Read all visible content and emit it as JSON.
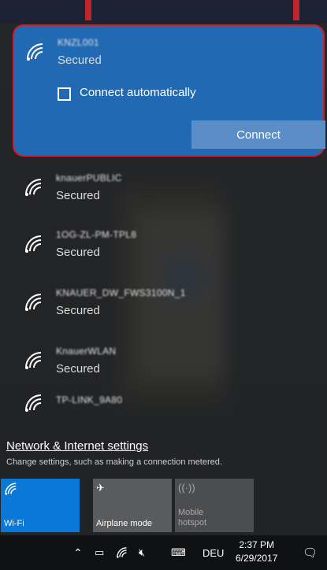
{
  "selected_network": {
    "name": "KNZL001",
    "status": "Secured",
    "connect_automatically_label": "Connect automatically",
    "connect_button": "Connect"
  },
  "networks": [
    {
      "name": "knauerPUBLIC",
      "status": "Secured"
    },
    {
      "name": "1OG-ZL-PM-TPL8",
      "status": "Secured"
    },
    {
      "name": "KNAUER_DW_FWS3100N_1",
      "status": "Secured"
    },
    {
      "name": "KnauerWLAN",
      "status": "Secured"
    },
    {
      "name": "TP-LINK_9A80",
      "status": ""
    }
  ],
  "settings": {
    "link": "Network & Internet settings",
    "description": "Change settings, such as making a connection metered."
  },
  "quick_actions": {
    "wifi": {
      "label": "Wi-Fi",
      "icon": "wifi-icon"
    },
    "airplane": {
      "label": "Airplane mode",
      "icon": "airplane-icon"
    },
    "hotspot": {
      "label_line1": "Mobile",
      "label_line2": "hotspot",
      "icon": "hotspot-icon"
    }
  },
  "taskbar": {
    "language": "DEU",
    "time": "2:37 PM",
    "date": "6/29/2017",
    "icons": [
      "chevron-up-icon",
      "battery-icon",
      "wifi-icon",
      "volume-muted-icon",
      "keyboard-icon",
      "notification-icon"
    ]
  },
  "colors": {
    "accent": "#0a78d7",
    "selected_bg": "#2169b3",
    "highlight_border": "#d11c2a"
  }
}
